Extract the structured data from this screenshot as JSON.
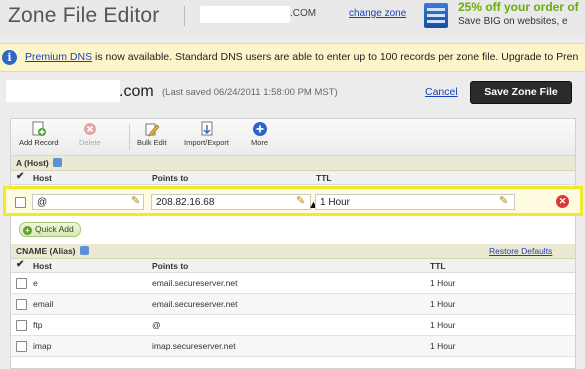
{
  "header": {
    "title": "Zone File Editor",
    "domain_suffix": ".COM",
    "change_zone": "change zone",
    "promo_line1": "25% off your order of",
    "promo_line2": "Save BIG on websites, e"
  },
  "notice": {
    "link": "Premium DNS",
    "text": " is now available. Standard DNS users are able to enter up to 100 records per zone file. Upgrade to Pren"
  },
  "domain_row": {
    "suffix": ".com",
    "last_saved": "(Last saved 06/24/2011 1:58:00 PM MST)",
    "cancel": "Cancel",
    "save": "Save Zone File"
  },
  "toolbar": {
    "add_record": "Add Record",
    "delete": "Delete",
    "bulk_edit": "Bulk Edit",
    "import_export": "Import/Export",
    "more": "More"
  },
  "a_section": {
    "title": "A (Host)",
    "columns": {
      "host": "Host",
      "points_to": "Points to",
      "ttl": "TTL"
    },
    "edit_row": {
      "host": "@",
      "points_to": "208.82.16.68",
      "ttl": "1 Hour"
    },
    "quick_add": "Quick Add"
  },
  "cname_section": {
    "title": "CNAME (Alias)",
    "restore": "Restore Defaults",
    "columns": {
      "host": "Host",
      "points_to": "Points to",
      "ttl": "TTL"
    },
    "rows": [
      {
        "host": "e",
        "points_to": "email.secureserver.net",
        "ttl": "1 Hour"
      },
      {
        "host": "email",
        "points_to": "email.secureserver.net",
        "ttl": "1 Hour"
      },
      {
        "host": "ftp",
        "points_to": "@",
        "ttl": "1 Hour"
      },
      {
        "host": "imap",
        "points_to": "imap.secureserver.net",
        "ttl": "1 Hour"
      }
    ]
  },
  "colors": {
    "accent_link": "#1a3fb5",
    "highlight": "#f1ea2c",
    "promo_green": "#6aaa12"
  },
  "icons": [
    "info-icon",
    "add-record-icon",
    "delete-icon",
    "bulk-edit-icon",
    "import-export-icon",
    "more-icon",
    "help-icon",
    "pencil-icon",
    "delete-x-icon",
    "plus-icon"
  ]
}
